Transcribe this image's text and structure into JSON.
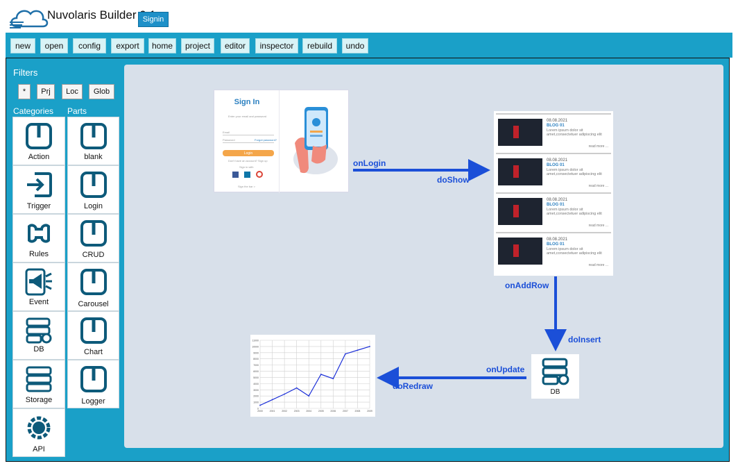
{
  "app": {
    "title": "Nuvolaris Builder 0.1",
    "signin_label": "Signin"
  },
  "toolbar": {
    "buttons": [
      "new",
      "open",
      "config",
      "export",
      "home",
      "project",
      "editor",
      "inspector",
      "rebuild",
      "undo"
    ]
  },
  "filters": {
    "title": "Filters",
    "buttons": [
      "*",
      "Prj",
      "Loc",
      "Glob"
    ]
  },
  "categories": {
    "title": "Categories",
    "items": [
      "Action",
      "Trigger",
      "Rules",
      "Event",
      "DB",
      "Storage",
      "API"
    ]
  },
  "parts": {
    "title": "Parts",
    "items": [
      "blank",
      "Login",
      "CRUD",
      "Carousel",
      "Chart",
      "Logger"
    ]
  },
  "canvas": {
    "signin_node": {
      "title": "Sign In",
      "subtitle": "Enter your email and password",
      "email_label": "Email",
      "password_label": "Password",
      "forgot_label": "Forgot password?",
      "login_label": "Login",
      "signup_label": "Don't have an account? Sign up",
      "or_label": "Sign in with",
      "footer_label": "Sign the bar >"
    },
    "blog_node": {
      "cards": [
        {
          "date": "08.08.2021",
          "title": "BLOG 01",
          "text": "Lorem ipsum dolor sit amet,consectetuer adipiscing elit",
          "more": "read more ..."
        },
        {
          "date": "08.08.2021",
          "title": "BLOG 01",
          "text": "Lorem ipsum dolor sit amet,consectetuer adipiscing elit",
          "more": "read more ..."
        },
        {
          "date": "08.08.2021",
          "title": "BLOG 01",
          "text": "Lorem ipsum dolor sit amet,consectetuer adipiscing elit",
          "more": "read more ..."
        },
        {
          "date": "08.08.2021",
          "title": "BLOG 01",
          "text": "Lorem ipsum dolor sit amet,consectetuer adipiscing elit",
          "more": "read more ..."
        }
      ]
    },
    "db_node": {
      "label": "DB"
    },
    "edges": {
      "on_login": "onLogin",
      "do_show": "doShow",
      "on_add_row": "onAddRow",
      "do_insert": "doInsert",
      "on_update": "onUpdate",
      "do_redraw": "doRedraw"
    }
  },
  "colors": {
    "toolbar": "#1aa0c8",
    "canvas": "#d8e0ea",
    "icon": "#0d5a7a",
    "edge": "#1b4fd8"
  },
  "chart_data": {
    "type": "line",
    "title": "",
    "xlabel": "",
    "ylabel": "",
    "x": [
      "2000",
      "2001",
      "2002",
      "2003",
      "2004",
      "2005",
      "2006",
      "2007",
      "2008",
      "2009"
    ],
    "ylim": [
      0,
      11000
    ],
    "series": [
      {
        "values": [
          500,
          1400,
          2300,
          3300,
          2000,
          5500,
          4800,
          8800,
          9400,
          10000
        ]
      }
    ],
    "grid": true
  }
}
